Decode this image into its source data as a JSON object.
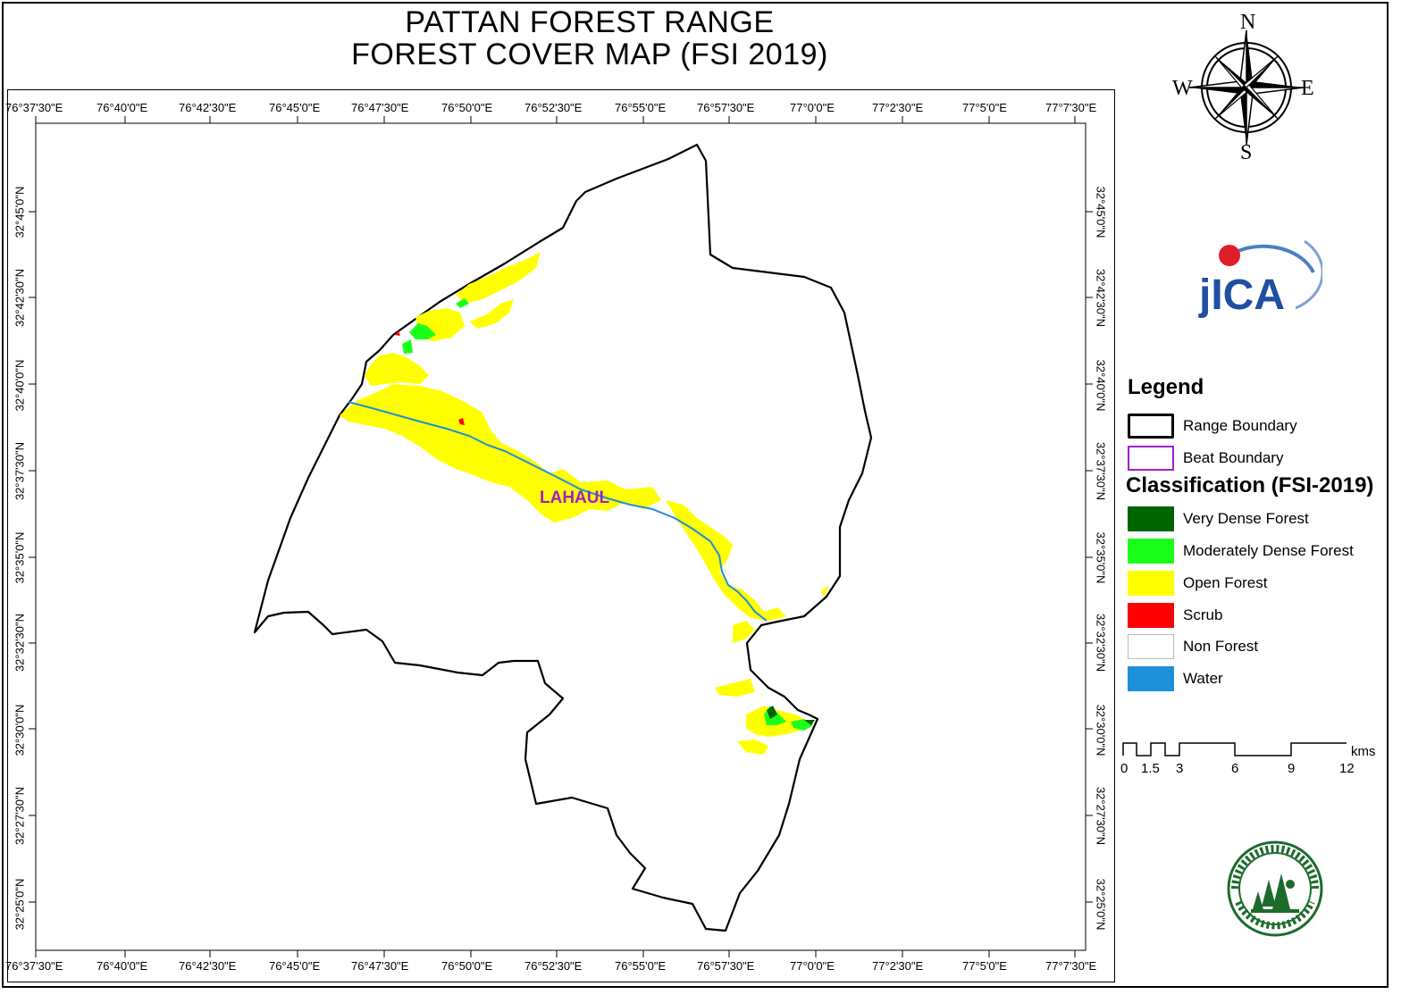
{
  "title": {
    "line1": "PATTAN FOREST RANGE",
    "line2": "FOREST COVER MAP (FSI 2019)"
  },
  "compass": {
    "n": "N",
    "s": "S",
    "e": "E",
    "w": "W"
  },
  "logo_text": "jICA",
  "top_ticks": [
    "76°37'30\"E",
    "76°40'0\"E",
    "76°42'30\"E",
    "76°45'0\"E",
    "76°47'30\"E",
    "76°50'0\"E",
    "76°52'30\"E",
    "76°55'0\"E",
    "76°57'30\"E",
    "77°0'0\"E",
    "77°2'30\"E",
    "77°5'0\"E",
    "77°7'30\"E"
  ],
  "bottom_ticks": [
    "76°37'30\"E",
    "76°40'0\"E",
    "76°42'30\"E",
    "76°45'0\"E",
    "76°47'30\"E",
    "76°50'0\"E",
    "76°52'30\"E",
    "76°55'0\"E",
    "76°57'30\"E",
    "77°0'0\"E",
    "77°2'30\"E",
    "77°5'0\"E",
    "77°7'30\"E"
  ],
  "left_ticks": [
    "32°45'0\"N",
    "32°42'30\"N",
    "32°40'0\"N",
    "32°37'30\"N",
    "32°35'0\"N",
    "32°32'30\"N",
    "32°30'0\"N",
    "32°27'30\"N",
    "32°25'0\"N"
  ],
  "right_ticks": [
    "32°45'0\"N",
    "32°42'30\"N",
    "32°40'0\"N",
    "32°37'30\"N",
    "32°35'0\"N",
    "32°32'30\"N",
    "32°30'0\"N",
    "32°27'30\"N",
    "32°25'0\"N"
  ],
  "map_label": "LAHAUL",
  "legend": {
    "title": "Legend",
    "boundaries": [
      {
        "label": "Range Boundary",
        "color": "#000000"
      },
      {
        "label": "Beat Boundary",
        "color": "#a020c8"
      }
    ],
    "classification_title": "Classification (FSI-2019)",
    "classes": [
      {
        "label": "Very Dense Forest",
        "color": "#006400"
      },
      {
        "label": "Moderately Dense Forest",
        "color": "#1aff1a"
      },
      {
        "label": "Open Forest",
        "color": "#ffff00"
      },
      {
        "label": "Scrub",
        "color": "#ff0000"
      },
      {
        "label": "Non Forest",
        "color": "#ffffff"
      },
      {
        "label": "Water",
        "color": "#1e90d8"
      }
    ]
  },
  "scale_bar": {
    "labels": [
      "0",
      "1.5",
      "3",
      "6",
      "9",
      "12"
    ],
    "unit": "kms"
  }
}
